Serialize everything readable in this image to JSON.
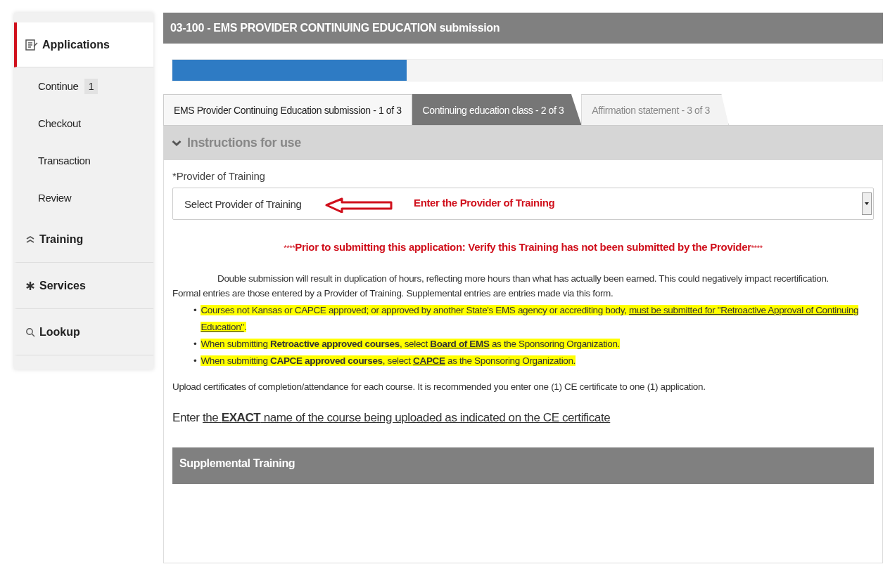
{
  "sidebar": {
    "items": [
      {
        "label": "Applications",
        "selected": true,
        "children": [
          {
            "label": "Continue",
            "badge": "1",
            "selected": false
          },
          {
            "label": "Checkout",
            "selected": false
          },
          {
            "label": "Transaction",
            "selected": false
          },
          {
            "label": "Review",
            "selected": false
          }
        ]
      },
      {
        "label": "Training",
        "selected": false
      },
      {
        "label": "Services",
        "selected": false
      },
      {
        "label": "Lookup",
        "selected": false
      }
    ]
  },
  "form": {
    "title": "03-100 - EMS PROVIDER CONTINUING EDUCATION submission",
    "progress": {
      "level": 0.33
    },
    "tabs": [
      {
        "label": "EMS Provider Continuing Education submission - 1 of 3",
        "selected": false
      },
      {
        "label": "Continuing education class - 2 of 3",
        "selected": true
      },
      {
        "label": "Affirmation statement - 3 of 3",
        "selected": false
      }
    ],
    "instructions": {
      "label": "Instructions for use",
      "expanded": true
    },
    "provider_field": {
      "label": "*Provider of Training",
      "placeholder": "Select Provider of Training",
      "annotation": "Enter the Provider of Training"
    },
    "warning": {
      "prefix": "****",
      "text": "Prior to submitting this application: Verify this Training has not been submitted by the Provider",
      "suffix": "****"
    },
    "notice": "Double submission will result in duplication of hours, reflecting more hours than what has actually been earned. This could negatively impact recertification.",
    "formal_note": "Formal entries are those entered by a Provider of Training.  Supplemental entries are entries made via this form.",
    "bullets": [
      {
        "marker": "•",
        "segments": [
          {
            "text": "Courses not Kansas or CAPCE approved; or approved by another State's EMS agency or accrediting body, "
          },
          {
            "text": "must be submitted for \"Retroactive Approval of Continuing Education\"",
            "underline": true
          },
          {
            "text": "."
          }
        ]
      },
      {
        "marker": "•",
        "segments": [
          {
            "text": "When submitting "
          },
          {
            "text": "Retroactive approved courses",
            "bold": true
          },
          {
            "text": ", select "
          },
          {
            "text": "Board of EMS",
            "bold": true,
            "underline": true
          },
          {
            "text": " as the Sponsoring Organization."
          }
        ]
      },
      {
        "marker": "•",
        "segments": [
          {
            "text": "When submitting "
          },
          {
            "text": "CAPCE approved courses",
            "bold": true
          },
          {
            "text": ", select "
          },
          {
            "text": "CAPCE",
            "bold": true,
            "underline": true
          },
          {
            "text": " as the Sponsoring Organization."
          }
        ]
      }
    ],
    "upload_note": "Upload certificates of completion/attendance for each course. It is recommended you enter one (1) CE certificate to one (1) application.",
    "exact_note": {
      "segments": [
        {
          "text": "Enter "
        },
        {
          "text": "the ",
          "underline": true
        },
        {
          "text": "EXACT",
          "bold": true,
          "underline": true
        },
        {
          "text": " name of the course being uploaded as indicated on the CE certificate",
          "underline": true
        }
      ]
    },
    "section_header": "Supplemental Training"
  }
}
